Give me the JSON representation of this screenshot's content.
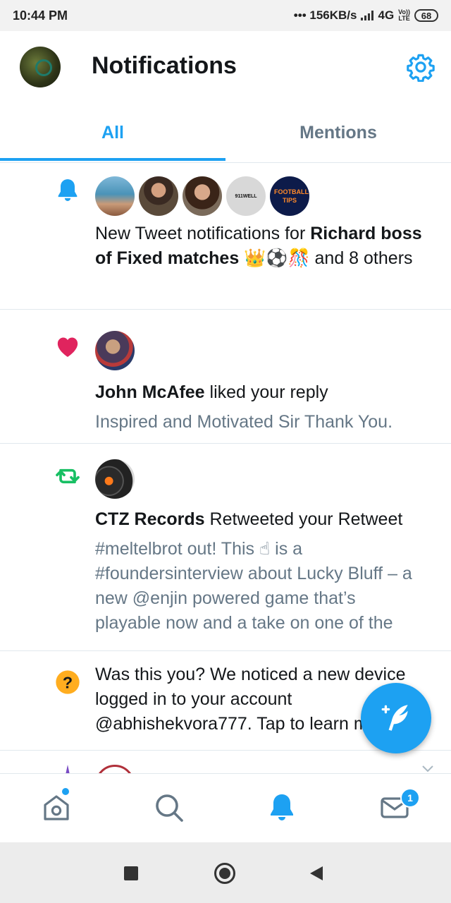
{
  "status": {
    "time": "10:44 PM",
    "speed": "••• 156KB/s",
    "network": "4G",
    "volte_top": "Vo))",
    "volte_bottom": "LTE",
    "battery": "68"
  },
  "header": {
    "title": "Notifications"
  },
  "tabs": [
    {
      "label": "All",
      "active": true
    },
    {
      "label": "Mentions",
      "active": false
    }
  ],
  "notifications": [
    {
      "type": "new-tweet",
      "text_prefix": "New Tweet notifications for ",
      "bold_name": "Richard boss of Fixed matches",
      "emoji": "👑⚽🎊",
      "text_suffix": " and 8 others",
      "avatar_labels": [
        "",
        "",
        "",
        "911WELL",
        "FOOTBALL TIPS"
      ]
    },
    {
      "type": "like",
      "bold_name": "John McAfee",
      "action": " liked your reply",
      "sub": "Inspired and Motivated Sir Thank You."
    },
    {
      "type": "retweet",
      "bold_name": "CTZ Records",
      "action": " Retweeted your Retweet",
      "sub": "#meltelbrot out! This ☝ is a #foundersinterview about Lucky Bluff – a new @enjin powered game that’s playable now and a take on one of the o…"
    },
    {
      "type": "security",
      "text": "Was this you? We noticed a new device logged in to your account @abhishekvora777. Tap to learn more."
    }
  ],
  "bottom_nav": {
    "messages_badge": "1"
  },
  "colors": {
    "accent": "#1da1f2",
    "like": "#e0245e",
    "retweet": "#17bf63",
    "warning": "#ffad1f",
    "muted": "#657786"
  }
}
